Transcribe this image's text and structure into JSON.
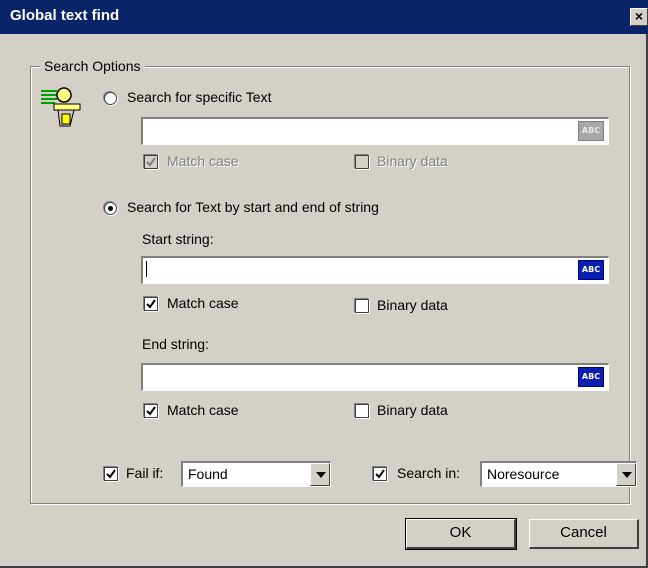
{
  "window": {
    "title": "Global text find",
    "close_label": "×"
  },
  "group": {
    "label": "Search Options"
  },
  "specific": {
    "radio_label": "Search for specific Text",
    "selected": false,
    "input_value": "",
    "match_case_label": "Match case",
    "match_case_checked": true,
    "binary_label": "Binary data",
    "binary_checked": false,
    "abc_label": "ABC"
  },
  "startend": {
    "radio_label": "Search for Text by start and end of string",
    "selected": true,
    "start_label": "Start string:",
    "start_value": "",
    "start_match_case_label": "Match case",
    "start_match_case_checked": true,
    "start_binary_label": "Binary data",
    "start_binary_checked": false,
    "end_label": "End string:",
    "end_value": "",
    "end_match_case_label": "Match case",
    "end_match_case_checked": true,
    "end_binary_label": "Binary data",
    "end_binary_checked": false,
    "abc_label": "ABC"
  },
  "fail_if": {
    "label": "Fail if:",
    "checked": true,
    "value": "Found"
  },
  "search_in": {
    "label": "Search in:",
    "checked": true,
    "value": "Noresource"
  },
  "buttons": {
    "ok": "OK",
    "cancel": "Cancel"
  }
}
